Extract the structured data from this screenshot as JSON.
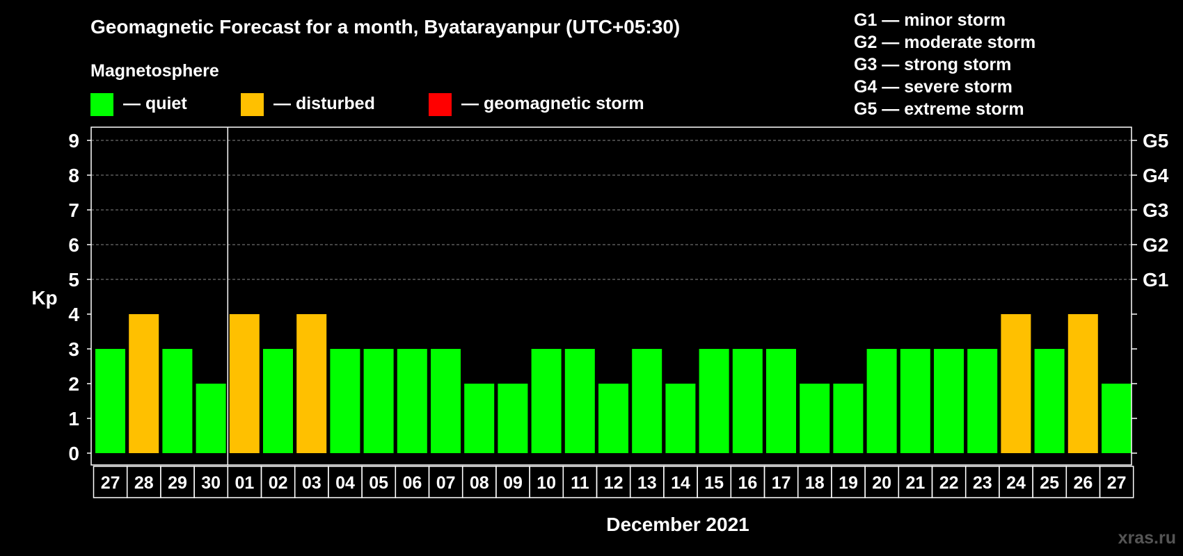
{
  "header": {
    "title": "Geomagnetic Forecast for a month, Byatarayanpur (UTC+05:30)",
    "subtitle": "Magnetosphere"
  },
  "legend": {
    "items": [
      {
        "label": "— quiet",
        "color": "#00ff00"
      },
      {
        "label": "— disturbed",
        "color": "#ffc000"
      },
      {
        "label": "— geomagnetic storm",
        "color": "#ff0000"
      }
    ]
  },
  "storm_levels": [
    "G1 — minor storm",
    "G2 — moderate storm",
    "G3 — strong storm",
    "G4 — severe storm",
    "G5 — extreme storm"
  ],
  "watermark": "xras.ru",
  "chart_data": {
    "type": "bar",
    "ylabel": "Kp",
    "xlabel": "December 2021",
    "ylim": [
      0,
      9
    ],
    "yticks": [
      "0",
      "1",
      "2",
      "3",
      "4",
      "5",
      "6",
      "7",
      "8",
      "9"
    ],
    "right_ticks": [
      {
        "value": 5,
        "label": "G1"
      },
      {
        "value": 6,
        "label": "G2"
      },
      {
        "value": 7,
        "label": "G3"
      },
      {
        "value": 8,
        "label": "G4"
      },
      {
        "value": 9,
        "label": "G5"
      }
    ],
    "grid": "dashed horizontal at 5-9",
    "categories": [
      "27",
      "28",
      "29",
      "30",
      "01",
      "02",
      "03",
      "04",
      "05",
      "06",
      "07",
      "08",
      "09",
      "10",
      "11",
      "12",
      "13",
      "14",
      "15",
      "16",
      "17",
      "18",
      "19",
      "20",
      "21",
      "22",
      "23",
      "24",
      "25",
      "26",
      "27"
    ],
    "values": [
      3,
      4,
      3,
      2,
      4,
      3,
      4,
      3,
      3,
      3,
      3,
      2,
      2,
      3,
      3,
      2,
      3,
      2,
      3,
      3,
      3,
      2,
      2,
      3,
      3,
      3,
      3,
      4,
      3,
      4,
      2
    ],
    "status": [
      "quiet",
      "disturbed",
      "quiet",
      "quiet",
      "disturbed",
      "quiet",
      "disturbed",
      "quiet",
      "quiet",
      "quiet",
      "quiet",
      "quiet",
      "quiet",
      "quiet",
      "quiet",
      "quiet",
      "quiet",
      "quiet",
      "quiet",
      "quiet",
      "quiet",
      "quiet",
      "quiet",
      "quiet",
      "quiet",
      "quiet",
      "quiet",
      "disturbed",
      "quiet",
      "disturbed",
      "quiet"
    ],
    "month_divider_after_index": 3,
    "colors": {
      "quiet": "#00ff00",
      "disturbed": "#ffc000",
      "storm": "#ff0000"
    }
  }
}
